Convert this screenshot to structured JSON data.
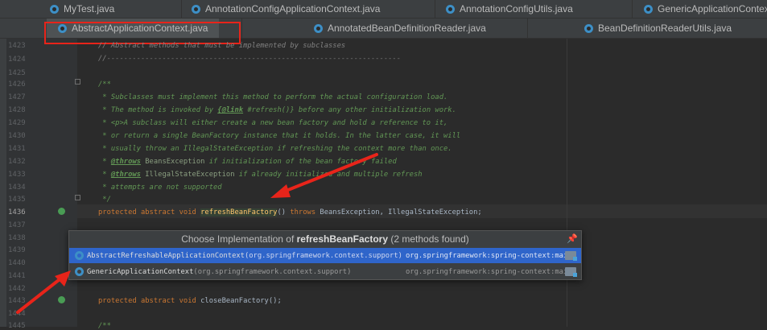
{
  "tabs_row1": [
    {
      "label": "MyTest.java"
    },
    {
      "label": "AnnotationConfigApplicationContext.java"
    },
    {
      "label": "AnnotationConfigUtils.java"
    },
    {
      "label": "GenericApplicationContext.java"
    }
  ],
  "tabs_row2": [
    {
      "label": "AbstractApplicationContext.java",
      "active": true
    },
    {
      "label": "AnnotatedBeanDefinitionReader.java"
    },
    {
      "label": "BeanDefinitionReaderUtils.java"
    }
  ],
  "line_numbers": [
    "1423",
    "1424",
    "1425",
    "1426",
    "1427",
    "1428",
    "1429",
    "1430",
    "1431",
    "1432",
    "1433",
    "1434",
    "1435",
    "1436",
    "1437",
    "1438",
    "1439",
    "1440",
    "1441",
    "1442",
    "1443",
    "1444",
    "1445"
  ],
  "code": {
    "l1423": "// Abstract methods that must be implemented by subclasses",
    "l1424": "//---------------------------------------------------------------------",
    "l1426": "/**",
    "l1427": " * Subclasses must implement this method to perform the actual configuration load.",
    "l1428a": " * The method is invoked by ",
    "l1428tag": "{@link",
    "l1428b": " #refresh()} before any other initialization work.",
    "l1429": " * <p>A subclass will either create a new bean factory and hold a reference to it,",
    "l1430": " * or return a single BeanFactory instance that it holds. In the latter case, it will",
    "l1431": " * usually throw an IllegalStateException if refreshing the context more than once.",
    "l1432a": " * ",
    "l1432tag": "@throws",
    "l1432b": " BeansException",
    "l1432c": " if initialization of the bean factory failed",
    "l1433a": " * ",
    "l1433tag": "@throws",
    "l1433b": " IllegalStateException",
    "l1433c": " if already initialized and multiple refresh",
    "l1434": " * attempts are not supported",
    "l1435": " */",
    "l1436kw": "protected abstract void ",
    "l1436m": "refreshBeanFactory",
    "l1436b": "() ",
    "l1436kw2": "throws ",
    "l1436c": "BeansException, IllegalStateException;",
    "l1442kw": "protected abstract void ",
    "l1442b": "closeBeanFactory();",
    "l1444": "/**"
  },
  "popup": {
    "title_prefix": "Choose Implementation of ",
    "title_method": "refreshBeanFactory",
    "title_suffix": " (2 methods found)",
    "items": [
      {
        "name": "AbstractRefreshableApplicationContext",
        "package": " (org.springframework.context.support)",
        "library": "org.springframework:spring-context:main",
        "selected": true
      },
      {
        "name": "GenericApplicationContext",
        "package": " (org.springframework.context.support)",
        "library": "org.springframework:spring-context:main",
        "selected": false
      }
    ]
  },
  "colors": {
    "annotation_red": "#e8241a",
    "selection_blue": "#2f65ca",
    "comment_green": "#629755",
    "keyword_orange": "#cc7832"
  }
}
